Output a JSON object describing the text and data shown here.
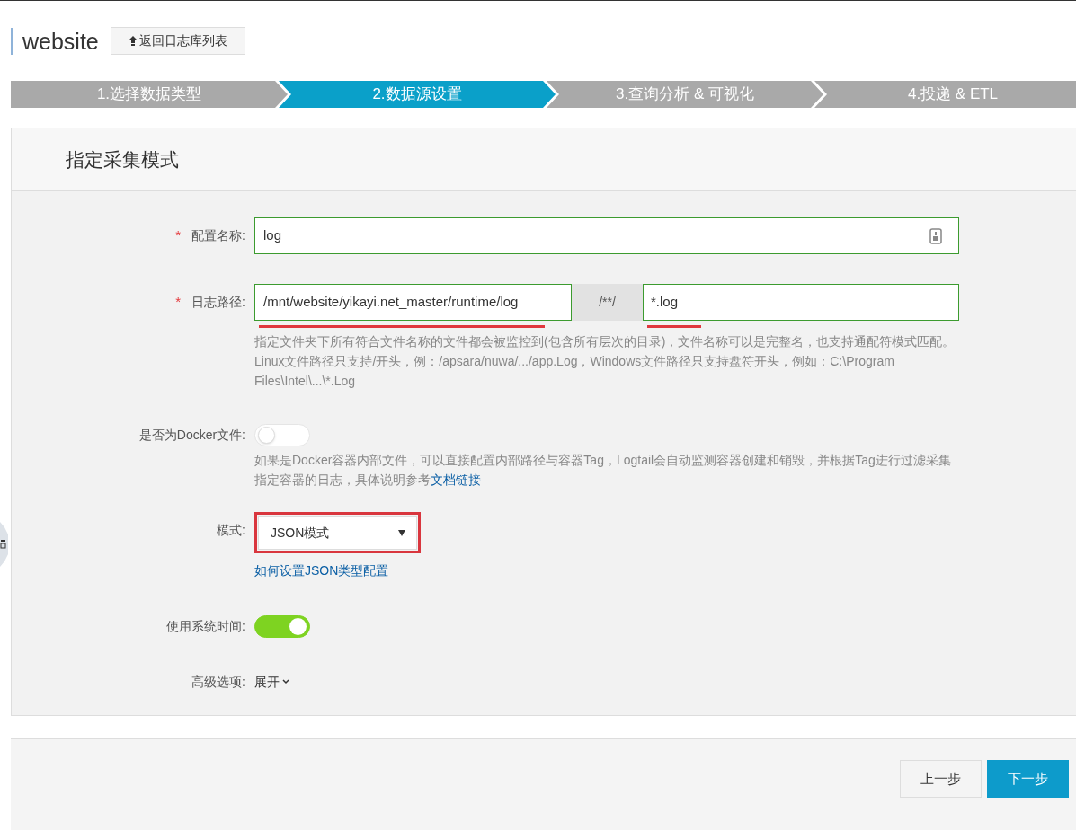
{
  "header": {
    "title": "website",
    "back_button": "返回日志库列表"
  },
  "steps": [
    {
      "label": "1.选择数据类型",
      "selected": false
    },
    {
      "label": "2.数据源设置",
      "selected": true
    },
    {
      "label": "3.查询分析 & 可视化",
      "selected": false
    },
    {
      "label": "4.投递 & ETL",
      "selected": false
    }
  ],
  "section_title": "指定采集模式",
  "form": [
    {
      "kind": "text",
      "label": "配置名称:",
      "required_mark": "*",
      "value": "log"
    },
    {
      "kind": "path",
      "label": "日志路径:",
      "required_mark": "*",
      "value": "/mnt/website/yikayi.net_master/runtime/log",
      "separator": "/**/",
      "pattern": "*.log",
      "help": "指定文件夹下所有符合文件名称的文件都会被监控到(包含所有层次的目录)，文件名称可以是完整名，也支持通配符模式匹配。Linux文件路径只支持/开头，例：/apsara/nuwa/.../app.Log，Windows文件路径只支持盘符开头，例如：C:\\Program Files\\Intel\\...\\*.Log"
    },
    {
      "kind": "toggle",
      "label": "是否为Docker文件:",
      "on": false,
      "help": "如果是Docker容器内部文件，可以直接配置内部路径与容器Tag，Logtail会自动监测容器创建和销毁，并根据Tag进行过滤采集指定容器的日志，具体说明参考",
      "help_link": "文档链接"
    },
    {
      "kind": "select",
      "label": "模式:",
      "value": "JSON模式",
      "link": "如何设置JSON类型配置"
    },
    {
      "kind": "toggle",
      "label": "使用系统时间:",
      "on": true
    },
    {
      "kind": "expander",
      "label": "高级选项:",
      "value": "展开"
    }
  ],
  "footer": {
    "prev_button": "上一步",
    "next_button": "下一步"
  }
}
